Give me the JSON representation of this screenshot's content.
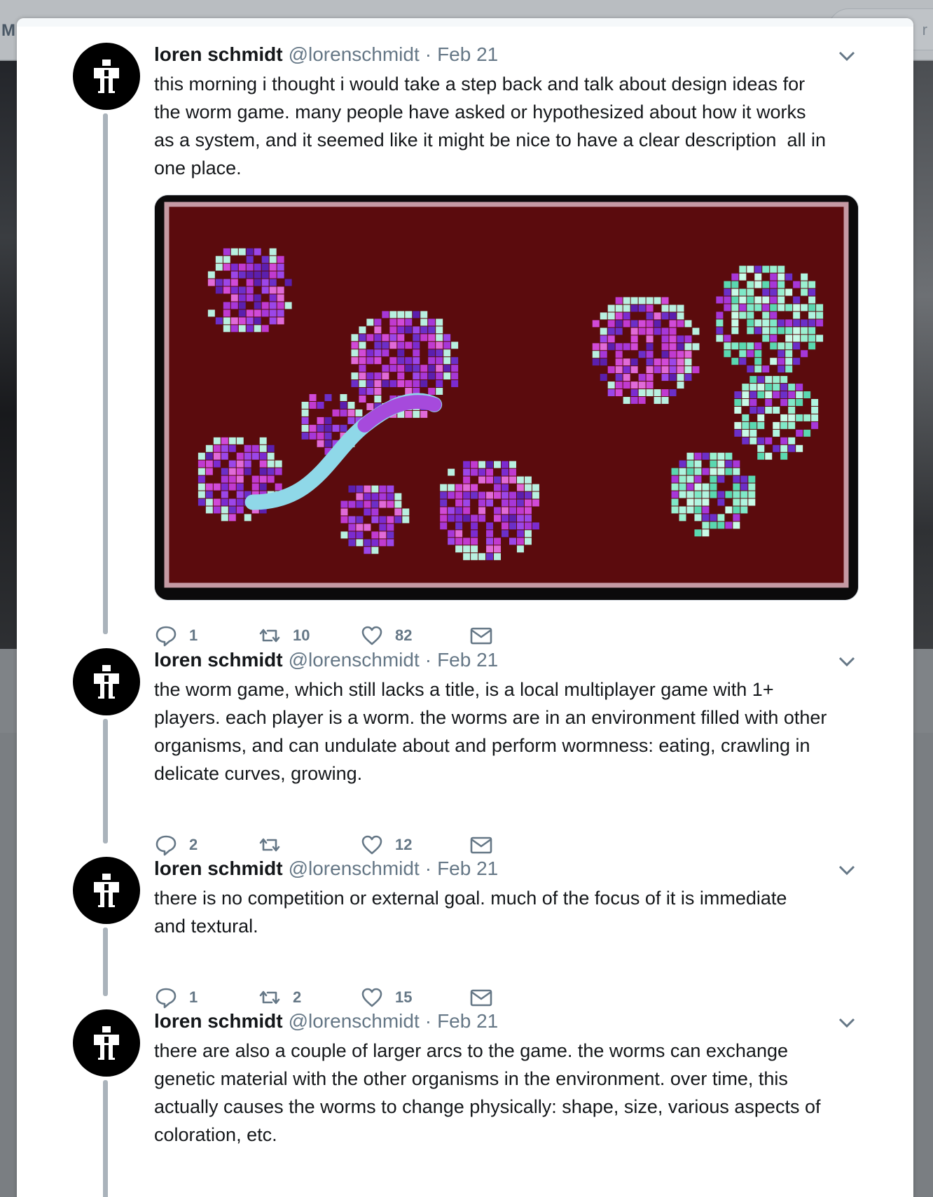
{
  "background": {
    "left_letter": "M",
    "right_letter": "r"
  },
  "colors": {
    "name": "#14171a",
    "meta": "#657786",
    "thread_line": "#aab3bb",
    "game_background": "#5a0a0c",
    "organism_purple": "#9b2fd6",
    "organism_mint": "#7fe9c8"
  },
  "tweets": [
    {
      "name": "loren schmidt",
      "handle": "@lorenschmidt",
      "separator": "·",
      "date": "Feb 21",
      "text": "this morning i thought i would take a step back and talk about design ideas for\nthe worm game. many people have asked or hypothesized about how it works\nas a system, and it seemed like it might be nice to have a clear description  all in\none place.",
      "has_media": true,
      "media_icon": "worm-game-screenshot",
      "replies": "1",
      "retweets": "10",
      "likes": "82"
    },
    {
      "name": "loren schmidt",
      "handle": "@lorenschmidt",
      "separator": "·",
      "date": "Feb 21",
      "text": "the worm game, which still lacks a title, is a local multiplayer game with 1+\nplayers. each player is a worm. the worms are in an environment filled with other\norganisms, and can undulate about and perform wormness: eating, crawling in\ndelicate curves, growing.",
      "replies": "2",
      "retweets": "",
      "likes": "12"
    },
    {
      "name": "loren schmidt",
      "handle": "@lorenschmidt",
      "separator": "·",
      "date": "Feb 21",
      "text": "there is no competition or external goal. much of the focus of it is immediate\nand textural.",
      "replies": "1",
      "retweets": "2",
      "likes": "15"
    },
    {
      "name": "loren schmidt",
      "handle": "@lorenschmidt",
      "separator": "·",
      "date": "Feb 21",
      "text": "there are also a couple of larger arcs to the game. the worms can exchange\ngenetic material with the other organisms in the environment. over time, this\nactually causes the worms to change physically: shape, size, various aspects of\ncoloration, etc."
    }
  ]
}
